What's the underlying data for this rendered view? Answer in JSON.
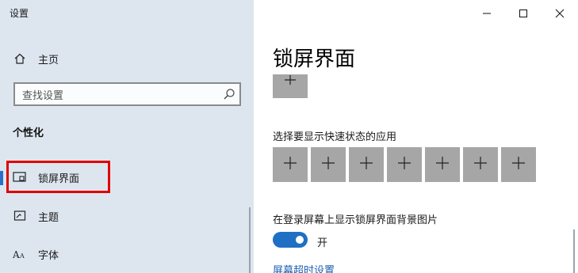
{
  "window": {
    "title": "设置",
    "controls": {
      "minimize_icon": "minimize-icon",
      "maximize_icon": "maximize-icon",
      "close_icon": "close-icon"
    }
  },
  "sidebar": {
    "home": {
      "icon": "home-icon",
      "label": "主页"
    },
    "search": {
      "placeholder": "查找设置",
      "icon": "search-icon"
    },
    "section_title": "个性化",
    "items": [
      {
        "icon": "lock-screen-icon",
        "label": "锁屏界面",
        "active": true
      },
      {
        "icon": "theme-icon",
        "label": "主题",
        "active": false
      },
      {
        "icon": "font-icon",
        "label": "字体",
        "active": false
      }
    ]
  },
  "main": {
    "title": "锁屏界面",
    "detailed_status_tile": {
      "icon": "plus-icon"
    },
    "quick_status": {
      "label": "选择要显示快速状态的应用",
      "tile_count": 7,
      "tile_icon": "plus-icon"
    },
    "background_on_signin": {
      "label": "在登录屏幕上显示锁屏界面背景图片",
      "toggle_on": true,
      "state_label": "开"
    },
    "timeout_link": "屏幕超时设置"
  },
  "colors": {
    "sidebar_bg": "#dde6ef",
    "accent": "#1f6fc4",
    "highlight_box": "#e00000",
    "tile_bg": "#a6a6a6"
  }
}
